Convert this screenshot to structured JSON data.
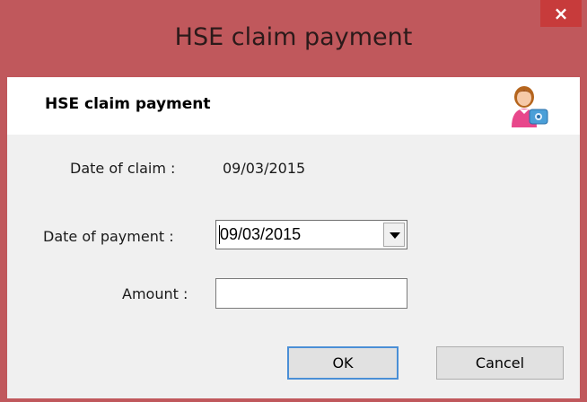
{
  "window": {
    "title": "HSE claim payment",
    "close_glyph": "×"
  },
  "header": {
    "title": "HSE claim payment",
    "icon": "person-with-card-icon"
  },
  "form": {
    "date_of_claim_label": "Date of claim :",
    "date_of_claim_value": "09/03/2015",
    "date_of_payment_label": "Date of payment :",
    "date_of_payment_value": "09/03/2015",
    "amount_label": "Amount :",
    "amount_value": ""
  },
  "buttons": {
    "ok_label": "OK",
    "cancel_label": "Cancel"
  },
  "colors": {
    "titlebar": "#c0585c",
    "close_button": "#c73b3b",
    "client_background": "#f0f0f0",
    "default_button_border": "#4a8fd6"
  }
}
